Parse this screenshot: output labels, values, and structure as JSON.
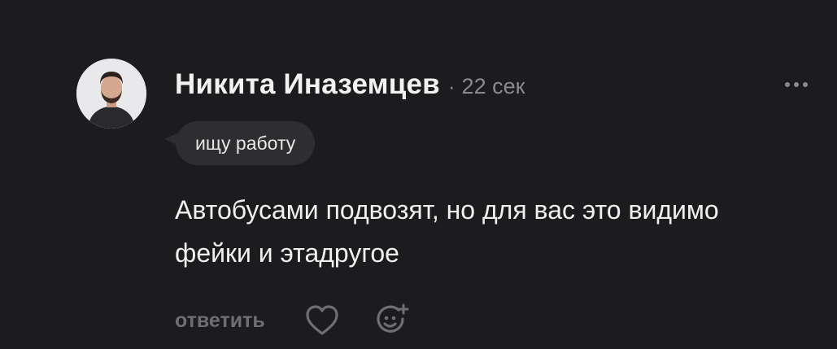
{
  "comment": {
    "author": "Никита Иназемцев",
    "separator": "·",
    "time": "22 сек",
    "tag": "ищу работу",
    "text": "Автобусами подвозят, но для вас это видимо фейки и этадругое",
    "actions": {
      "reply_label": "ответить"
    }
  },
  "icons": {
    "more": "more-dots-icon",
    "like": "heart-icon",
    "react": "add-reaction-icon",
    "avatar": "user-avatar"
  },
  "colors": {
    "background": "#1c1c1e",
    "primary_text": "#f0f0f0",
    "secondary_text": "#8a8a8e",
    "muted_action": "#6e6e73",
    "tag_background": "#2e2e31"
  }
}
